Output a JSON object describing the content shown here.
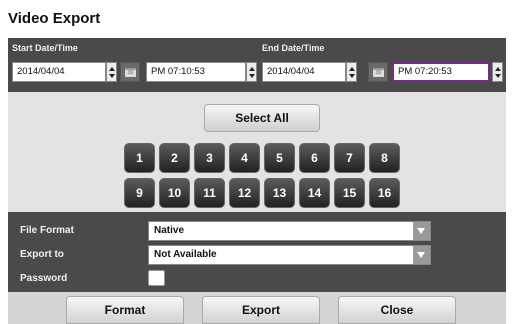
{
  "dialog": {
    "title": "Video Export"
  },
  "dates": {
    "start_label": "Start Date/Time",
    "end_label": "End Date/Time",
    "start_date": "2014/04/04",
    "start_time": "PM 07:10:53",
    "end_date": "2014/04/04",
    "end_time": "PM 07:20:53",
    "calendar_icon_text": "30"
  },
  "channels": {
    "select_all_label": "Select All",
    "buttons": [
      "1",
      "2",
      "3",
      "4",
      "5",
      "6",
      "7",
      "8",
      "9",
      "10",
      "11",
      "12",
      "13",
      "14",
      "15",
      "16"
    ]
  },
  "options": {
    "file_format_label": "File Format",
    "file_format_value": "Native",
    "export_to_label": "Export to",
    "export_to_value": "Not Available",
    "password_label": "Password",
    "password_checked": false
  },
  "footer": {
    "format_label": "Format",
    "export_label": "Export",
    "close_label": "Close"
  },
  "colors": {
    "dark_panel": "#4a4a4a",
    "light_panel": "#e3e3e3",
    "focus_border": "#7a2a8a"
  }
}
